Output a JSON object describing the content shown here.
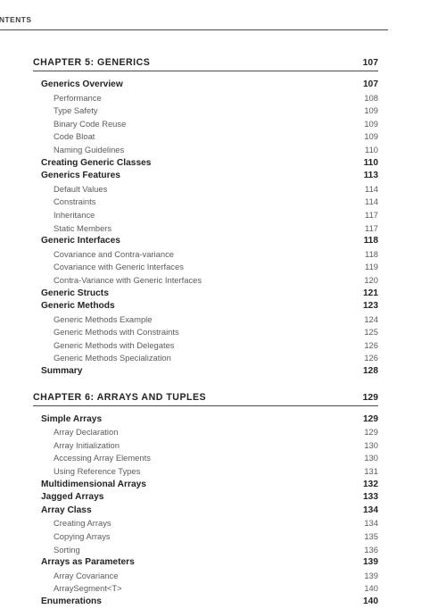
{
  "running_head": {
    "text": "NTENTS"
  },
  "toc": {
    "chapters": [
      {
        "title": "CHAPTER 5: GENERICS",
        "page": "107",
        "entries": [
          {
            "level": 1,
            "label": "Generics Overview",
            "page": "107"
          },
          {
            "level": 2,
            "label": "Performance",
            "page": "108"
          },
          {
            "level": 2,
            "label": "Type Safety",
            "page": "109"
          },
          {
            "level": 2,
            "label": "Binary Code Reuse",
            "page": "109"
          },
          {
            "level": 2,
            "label": "Code Bloat",
            "page": "109"
          },
          {
            "level": 2,
            "label": "Naming Guidelines",
            "page": "110"
          },
          {
            "level": 1,
            "label": "Creating Generic Classes",
            "page": "110"
          },
          {
            "level": 1,
            "label": "Generics Features",
            "page": "113"
          },
          {
            "level": 2,
            "label": "Default Values",
            "page": "114"
          },
          {
            "level": 2,
            "label": "Constraints",
            "page": "114"
          },
          {
            "level": 2,
            "label": "Inheritance",
            "page": "117"
          },
          {
            "level": 2,
            "label": "Static Members",
            "page": "117"
          },
          {
            "level": 1,
            "label": "Generic Interfaces",
            "page": "118"
          },
          {
            "level": 2,
            "label": "Covariance and Contra-variance",
            "page": "118"
          },
          {
            "level": 2,
            "label": "Covariance with Generic Interfaces",
            "page": "119"
          },
          {
            "level": 2,
            "label": "Contra-Variance with Generic Interfaces",
            "page": "120"
          },
          {
            "level": 1,
            "label": "Generic Structs",
            "page": "121"
          },
          {
            "level": 1,
            "label": "Generic Methods",
            "page": "123"
          },
          {
            "level": 2,
            "label": "Generic Methods Example",
            "page": "124"
          },
          {
            "level": 2,
            "label": "Generic Methods with Constraints",
            "page": "125"
          },
          {
            "level": 2,
            "label": "Generic Methods with Delegates",
            "page": "126"
          },
          {
            "level": 2,
            "label": "Generic Methods Specialization",
            "page": "126"
          },
          {
            "level": 1,
            "label": "Summary",
            "page": "128"
          }
        ]
      },
      {
        "title": "CHAPTER 6: ARRAYS AND TUPLES",
        "page": "129",
        "entries": [
          {
            "level": 1,
            "label": "Simple Arrays",
            "page": "129"
          },
          {
            "level": 2,
            "label": "Array Declaration",
            "page": "129"
          },
          {
            "level": 2,
            "label": "Array Initialization",
            "page": "130"
          },
          {
            "level": 2,
            "label": "Accessing Array Elements",
            "page": "130"
          },
          {
            "level": 2,
            "label": "Using Reference Types",
            "page": "131"
          },
          {
            "level": 1,
            "label": "Multidimensional Arrays",
            "page": "132"
          },
          {
            "level": 1,
            "label": "Jagged Arrays",
            "page": "133"
          },
          {
            "level": 1,
            "label": "Array Class",
            "page": "134"
          },
          {
            "level": 2,
            "label": "Creating Arrays",
            "page": "134"
          },
          {
            "level": 2,
            "label": "Copying Arrays",
            "page": "135"
          },
          {
            "level": 2,
            "label": "Sorting",
            "page": "136"
          },
          {
            "level": 1,
            "label": "Arrays as Parameters",
            "page": "139"
          },
          {
            "level": 2,
            "label": "Array Covariance",
            "page": "139"
          },
          {
            "level": 2,
            "label": "ArraySegment<T>",
            "page": "140"
          },
          {
            "level": 1,
            "label": "Enumerations",
            "page": "140"
          }
        ]
      }
    ]
  }
}
